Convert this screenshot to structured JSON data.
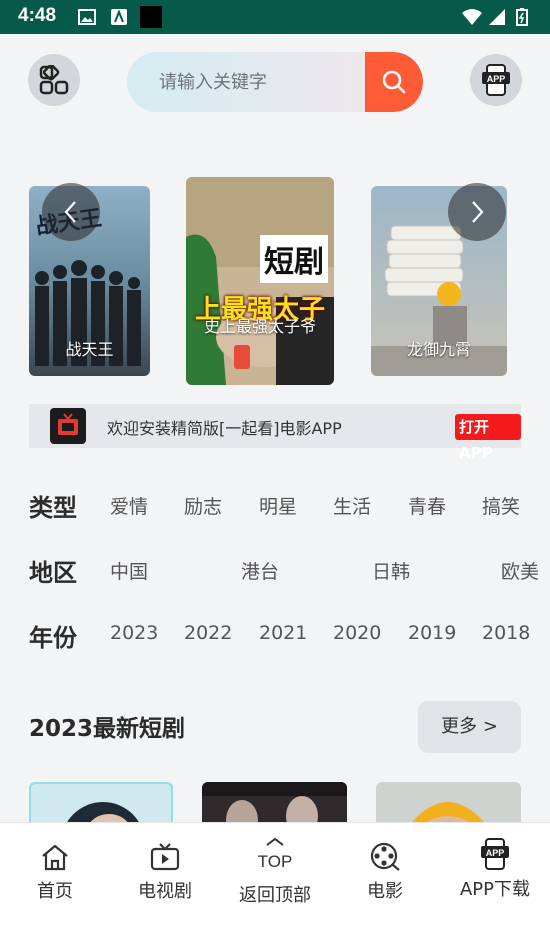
{
  "status_bar": {
    "time": "4:48"
  },
  "search": {
    "placeholder": "请输入关键字"
  },
  "carousel": [
    {
      "caption": "战天王"
    },
    {
      "caption": "史上最强太子爷",
      "poster_text_top": "短剧",
      "poster_text_bottom": "上最强太子"
    },
    {
      "caption": "龙御九霄"
    }
  ],
  "banner": {
    "text": "欢迎安装精简版[一起看]电影APP",
    "open_label": "打开APP"
  },
  "filters": {
    "type": {
      "label": "类型",
      "items": [
        "爱情",
        "励志",
        "明星",
        "生活",
        "青春",
        "搞笑"
      ]
    },
    "region": {
      "label": "地区",
      "items": [
        "中国",
        "港台",
        "日韩",
        "欧美"
      ]
    },
    "year": {
      "label": "年份",
      "items": [
        "2023",
        "2022",
        "2021",
        "2020",
        "2019",
        "2018"
      ]
    }
  },
  "section": {
    "title": "2023最新短剧",
    "more_label": "更多 >"
  },
  "tabs": [
    {
      "label": "首页",
      "icon": "home-icon"
    },
    {
      "label": "电视剧",
      "icon": "tv-icon"
    },
    {
      "label": "返回顶部",
      "icon": "top-icon",
      "top_text": "TOP"
    },
    {
      "label": "电影",
      "icon": "film-reel-icon"
    },
    {
      "label": "APP下载",
      "icon": "app-download-icon",
      "badge_text": "APP"
    }
  ],
  "colors": {
    "status_bar": "#07594a",
    "search_button": "#ff5b36",
    "open_app": "#f31b1b"
  }
}
